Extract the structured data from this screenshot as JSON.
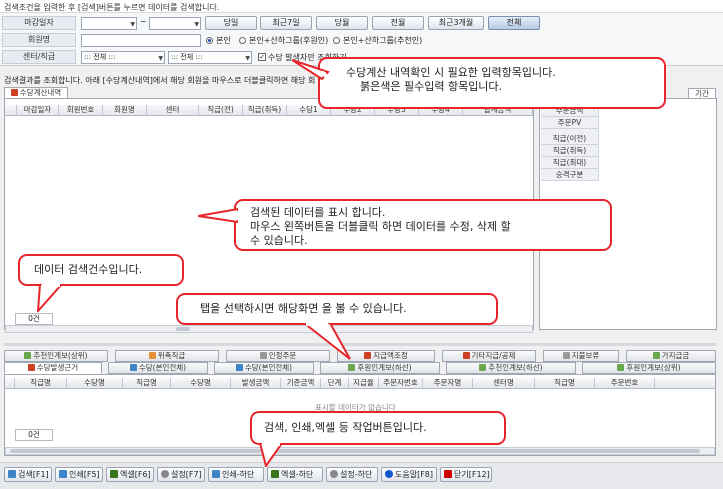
{
  "hint_top": "검색조건을 입력한 후 [검색]버튼를 누르면 데이터를 검색합니다.",
  "search": {
    "close_date_label": "마감일자",
    "member_label": "회원명",
    "center_label": "센터/직급",
    "date_sep": "~",
    "date_buttons": [
      "당일",
      "최근7일",
      "당월",
      "전월",
      "최근3개월",
      "전체"
    ],
    "radio_options": [
      "본인",
      "본인+산하그룹(후원인)",
      "본인+산하그룹(추천인)"
    ],
    "center_select": "::: 전체 :::",
    "grade_select": "::: 전체 :::",
    "only_issued_label": "수당 발생자만 조회하기"
  },
  "result_hint": "검색결과를 조회합니다. 아래 [수당계산내역]에서 해당 회원을 마우스로 더블클릭하면 해당 회",
  "main_tab": "수당계산내역",
  "main_columns": [
    "마감일자",
    "회원번호",
    "회원명",
    "센터",
    "직급(전)",
    "직급(취득)",
    "수당1",
    "수당2",
    "수당3",
    "수당4",
    "합계금액"
  ],
  "main_count": "0건",
  "side_tab": "기간",
  "side_rows": [
    "주문금액",
    "주문PV",
    "",
    "직급(이전)",
    "직급(취득)",
    "직급(최대)",
    "승격구분"
  ],
  "bottom_tabs_row1": [
    {
      "label": "추천인계보(상위)",
      "icon": "tree-icon",
      "color": "#6aa84f"
    },
    {
      "label": "위촉직급",
      "icon": "medal-icon",
      "color": "#e69138"
    },
    {
      "label": "인정주문",
      "icon": "cart-icon",
      "color": "#999999"
    },
    {
      "label": "지급액조정",
      "icon": "adjust-icon",
      "color": "#cc4125"
    },
    {
      "label": "기타지급/공제",
      "icon": "doc-icon",
      "color": "#cc4125"
    },
    {
      "label": "지불보류",
      "icon": "mail-icon",
      "color": "#999999"
    },
    {
      "label": "가지급금",
      "icon": "money-icon",
      "color": "#6aa84f"
    }
  ],
  "bottom_tabs_row2": [
    {
      "label": "수당발생근거",
      "icon": "doc-icon",
      "color": "#cc4125"
    },
    {
      "label": "수당(본인전체)",
      "icon": "table-icon",
      "color": "#3d85c6"
    },
    {
      "label": "수당(본인전체)",
      "icon": "table-icon",
      "color": "#3d85c6"
    },
    {
      "label": "후원인계보(하선)",
      "icon": "tree-icon",
      "color": "#6aa84f"
    },
    {
      "label": "추천인계보(하선)",
      "icon": "tree-icon",
      "color": "#6aa84f"
    },
    {
      "label": "후원인계보(상위)",
      "icon": "tree-icon",
      "color": "#6aa84f"
    }
  ],
  "bottom_columns": [
    "직급명",
    "수당명",
    "직급명",
    "수당명",
    "발생금액",
    "기준금액",
    "단계",
    "지급율",
    "주문자번호",
    "주문자명",
    "센터명",
    "직급명",
    "주문번호"
  ],
  "bottom_empty": "표시할 데이터가 없습니다",
  "bottom_count": "0건",
  "toolbar": [
    {
      "label": "검색[F1]",
      "icon": "search-icon",
      "color": "#3d85c6"
    },
    {
      "label": "인쇄[F5]",
      "icon": "print-icon",
      "color": "#3d85c6"
    },
    {
      "label": "엑셀[F6]",
      "icon": "excel-icon",
      "color": "#38761d"
    },
    {
      "label": "설정[F7]",
      "icon": "gear-icon",
      "color": "#888888"
    },
    {
      "label": "인쇄-하단",
      "icon": "print-icon",
      "color": "#3d85c6"
    },
    {
      "label": "엑셀-하단",
      "icon": "excel-icon",
      "color": "#38761d"
    },
    {
      "label": "설정-하단",
      "icon": "gear-icon",
      "color": "#888888"
    },
    {
      "label": "도움말[F8]",
      "icon": "help-icon",
      "color": "#1155cc"
    },
    {
      "label": "닫기[F12]",
      "icon": "close-icon",
      "color": "#cc0000"
    }
  ],
  "callouts": {
    "input": [
      "수당계산 내역확인 시 필요한 입력항목입니다.",
      "붉은색은 필수입력 항목입니다."
    ],
    "data": [
      "검색된 데이터를 표시 합니다.",
      "마우스 왼쪽버튼을 더블클릭 하면 데이터를 수정, 삭제 할",
      "수 있습니다."
    ],
    "count": [
      "데이터 검색건수입니다."
    ],
    "tab": [
      "탭을 선택하시면 해당화면 을 볼 수 있습니다."
    ],
    "toolbar": [
      "검색, 인쇄,엑셀 등 작업버튼입니다."
    ]
  },
  "colors": {
    "accent": "#e8252a",
    "required": "#e8252a"
  }
}
